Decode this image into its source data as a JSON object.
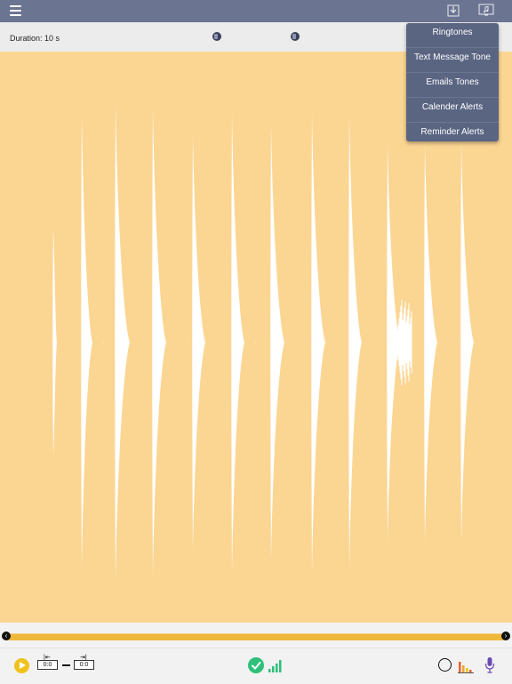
{
  "header": {
    "menu_icon": "hamburger-menu-icon",
    "download_icon": "download-tray-icon",
    "music_icon": "music-note-screen-icon"
  },
  "duration": {
    "label": "Duration:",
    "value": "10 s"
  },
  "ringtone_menu": {
    "items": [
      "Ringtones",
      "Text Message Tone",
      "Emails Tones",
      "Calender Alerts",
      "Reminder Alerts"
    ]
  },
  "waveform": {
    "color": "#fbd592",
    "wave_color": "#ffffff"
  },
  "scrubber": {
    "left_icon": "chevron-left-icon",
    "right_icon": "chevron-right-icon",
    "track_color": "#efb73c"
  },
  "controls": {
    "start_time": "0:0",
    "end_time": "0:0",
    "play_icon": "play-icon",
    "check_icon": "checkmark-icon",
    "signal_icon": "signal-bars-icon",
    "record_icon": "record-circle-icon",
    "equalizer_icon": "equalizer-icon",
    "mic_icon": "microphone-icon"
  },
  "colors": {
    "topbar": "#6b7491",
    "menu": "#5a6582",
    "accent_yellow": "#f0c21e",
    "accent_green": "#2ec07a"
  }
}
